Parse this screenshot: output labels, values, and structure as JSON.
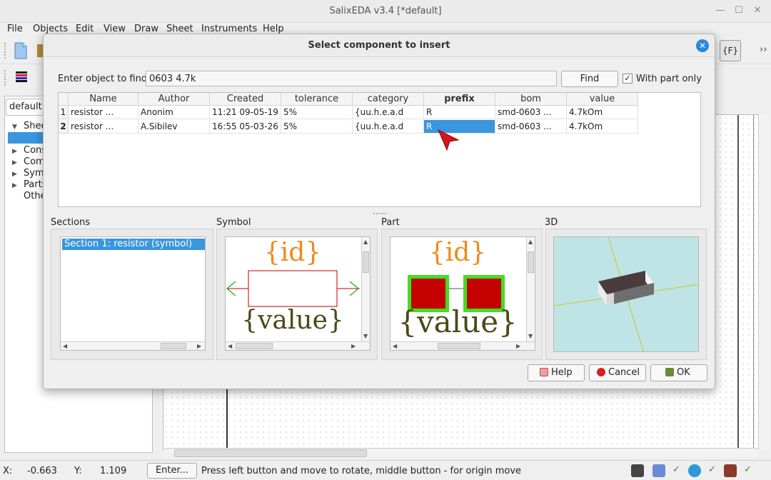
{
  "window": {
    "title": "SalixEDA v3.4 [*default]",
    "minimize_glyph": "—",
    "maximize_glyph": "☐",
    "close_glyph": "✕"
  },
  "menu": [
    "File",
    "Objects",
    "Edit",
    "View",
    "Draw",
    "Sheet",
    "Instruments",
    "Help"
  ],
  "toolbar": {
    "more_glyph": "››",
    "f_button": "{F}"
  },
  "sheet_combo": "default",
  "tree": {
    "items": [
      {
        "label": "Shee"
      },
      {
        "label": "Cons"
      },
      {
        "label": "Com"
      },
      {
        "label": "Sym"
      },
      {
        "label": "Parts"
      },
      {
        "label": "Othe"
      }
    ]
  },
  "dialog": {
    "title": "Select component to insert",
    "close_glyph": "✕",
    "find_label": "Enter object to find:",
    "find_value": "0603 4.7k",
    "find_button": "Find",
    "with_part_only_checked": true,
    "check_glyph": "✓",
    "with_part_only_label": "With part only",
    "columns": [
      "Name",
      "Author",
      "Created",
      "tolerance",
      "category",
      "prefix",
      "bom",
      "value"
    ],
    "rows": [
      {
        "num": "1",
        "cells": [
          "resistor ...",
          "Anonim",
          "11:21 09-05-19",
          "5%",
          "{uu.h.e.a.d",
          "R",
          "smd-0603 ...",
          "4.7kOm"
        ]
      },
      {
        "num": "2",
        "cells": [
          "resistor ...",
          "A.Sibilev",
          "16:55 05-03-26",
          "5%",
          "{uu.h.e.a.d",
          "R",
          "smd-0603 ...",
          "4.7kOm"
        ]
      }
    ],
    "selected_row": 1,
    "selected_col": 5,
    "sections_label": "Sections",
    "sections_items": [
      "Section 1: resistor (symbol)"
    ],
    "symbol_label": "Symbol",
    "part_label": "Part",
    "view3d_label": "3D",
    "symbol_id_text": "{id}",
    "symbol_value_text": "{value}",
    "part_id_text": "{id}",
    "part_value_text": "{value}",
    "help_button": "Help",
    "cancel_button": "Cancel",
    "ok_button": "OK"
  },
  "status": {
    "x_label": "X:",
    "x_value": "-0.663",
    "y_label": "Y:",
    "y_value": "1.109",
    "enter_button": "Enter...",
    "hint": "Press left button and move to rotate, middle button - for origin move",
    "check_glyph": "✓"
  },
  "colors": {
    "selection": "#3a96dd",
    "id_text": "#f0891a",
    "value_text": "#4a4a18",
    "pin_green": "#22b822",
    "pad_red": "#c40000",
    "pad_green": "#44dd22",
    "view3d_bg": "#bfe4e6"
  }
}
